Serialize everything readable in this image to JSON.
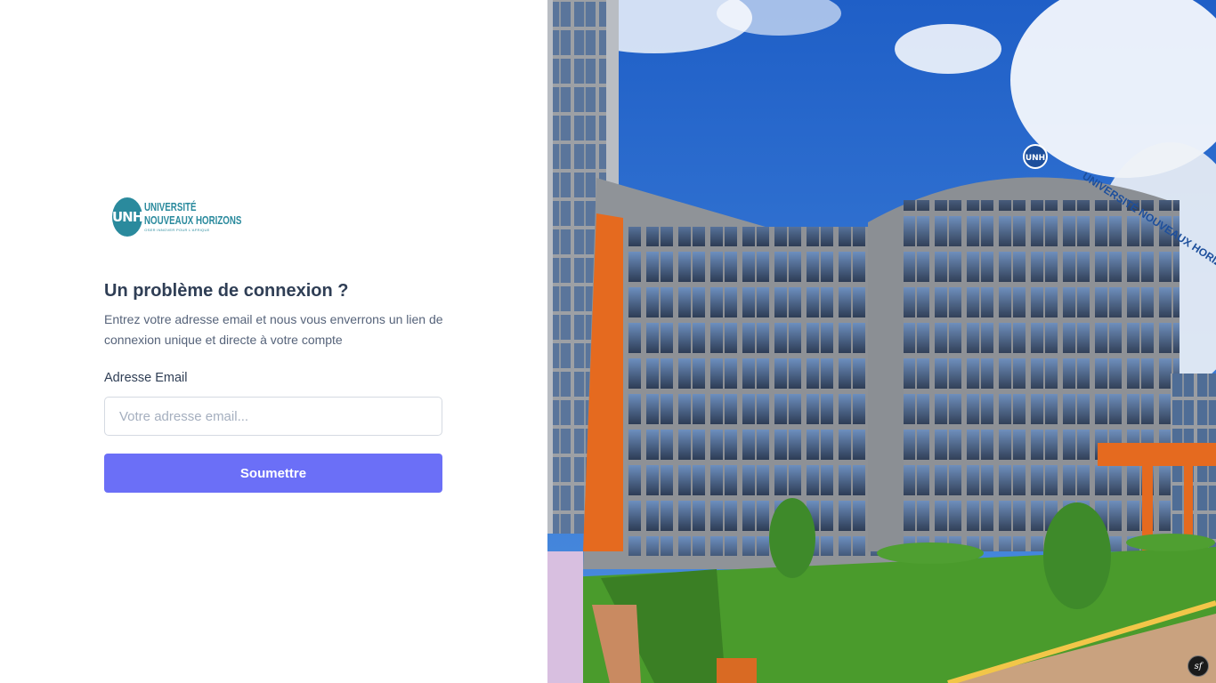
{
  "brand": {
    "monogram": "UNH",
    "name_line1": "UNIVERSITÉ",
    "name_line2": "NOUVEAUX HORIZONS",
    "tagline": "OSER INNOVER POUR L'AFRIQUE",
    "color": "#2a8a9d"
  },
  "form": {
    "title": "Un problème de connexion ?",
    "description": "Entrez votre adresse email et nous vous enverrons un lien de connexion unique et directe à votre compte",
    "email_label": "Adresse Email",
    "email_placeholder": "Votre adresse email...",
    "email_value": "",
    "submit_label": "Soumettre"
  },
  "colors": {
    "primary_button": "#6b6ff7",
    "heading": "#2f3e55",
    "body_text": "#56637a"
  },
  "photo": {
    "building_sign": "UNIVERSITÉ NOUVEAUX HORIZONS",
    "building_monogram": "UNH"
  },
  "debug_badge": {
    "text": "sf",
    "icon": "symfony-icon"
  }
}
